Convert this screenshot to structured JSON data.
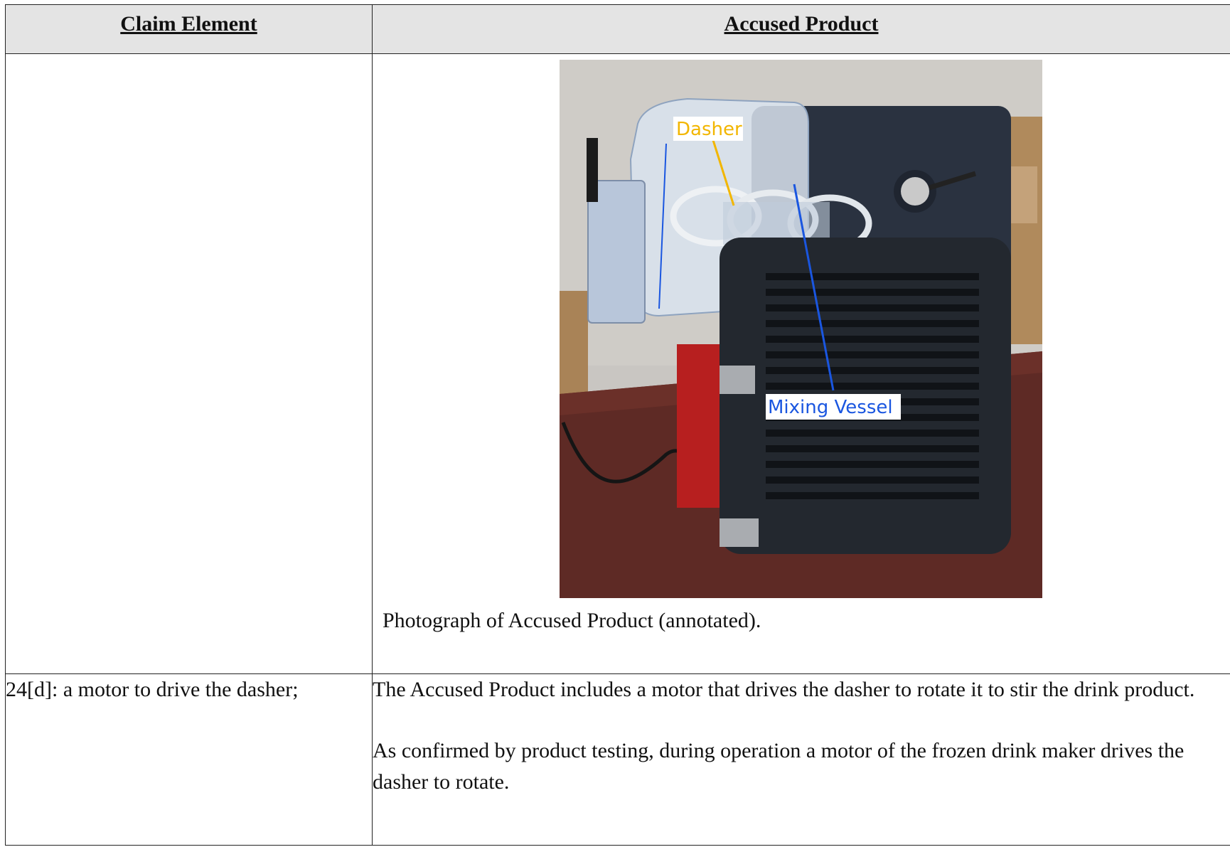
{
  "table": {
    "headers": {
      "claim_element": "Claim Element",
      "accused_product": "Accused Product"
    },
    "photo_row": {
      "caption": "Photograph of Accused Product (annotated).",
      "annotations": {
        "dasher": "Dasher",
        "mixing_vessel": "Mixing Vessel"
      }
    },
    "row_24d": {
      "claim": "24[d]: a motor to drive the dasher;",
      "para1": "The Accused Product includes a motor that drives the dasher to rotate it to stir the drink product.",
      "para2": "As confirmed by product testing, during operation a motor of the frozen drink maker drives the dasher to rotate."
    }
  },
  "colors": {
    "header_bg": "#e4e4e4",
    "dasher_label": "#f2b600",
    "vessel_label": "#1a56e0"
  }
}
